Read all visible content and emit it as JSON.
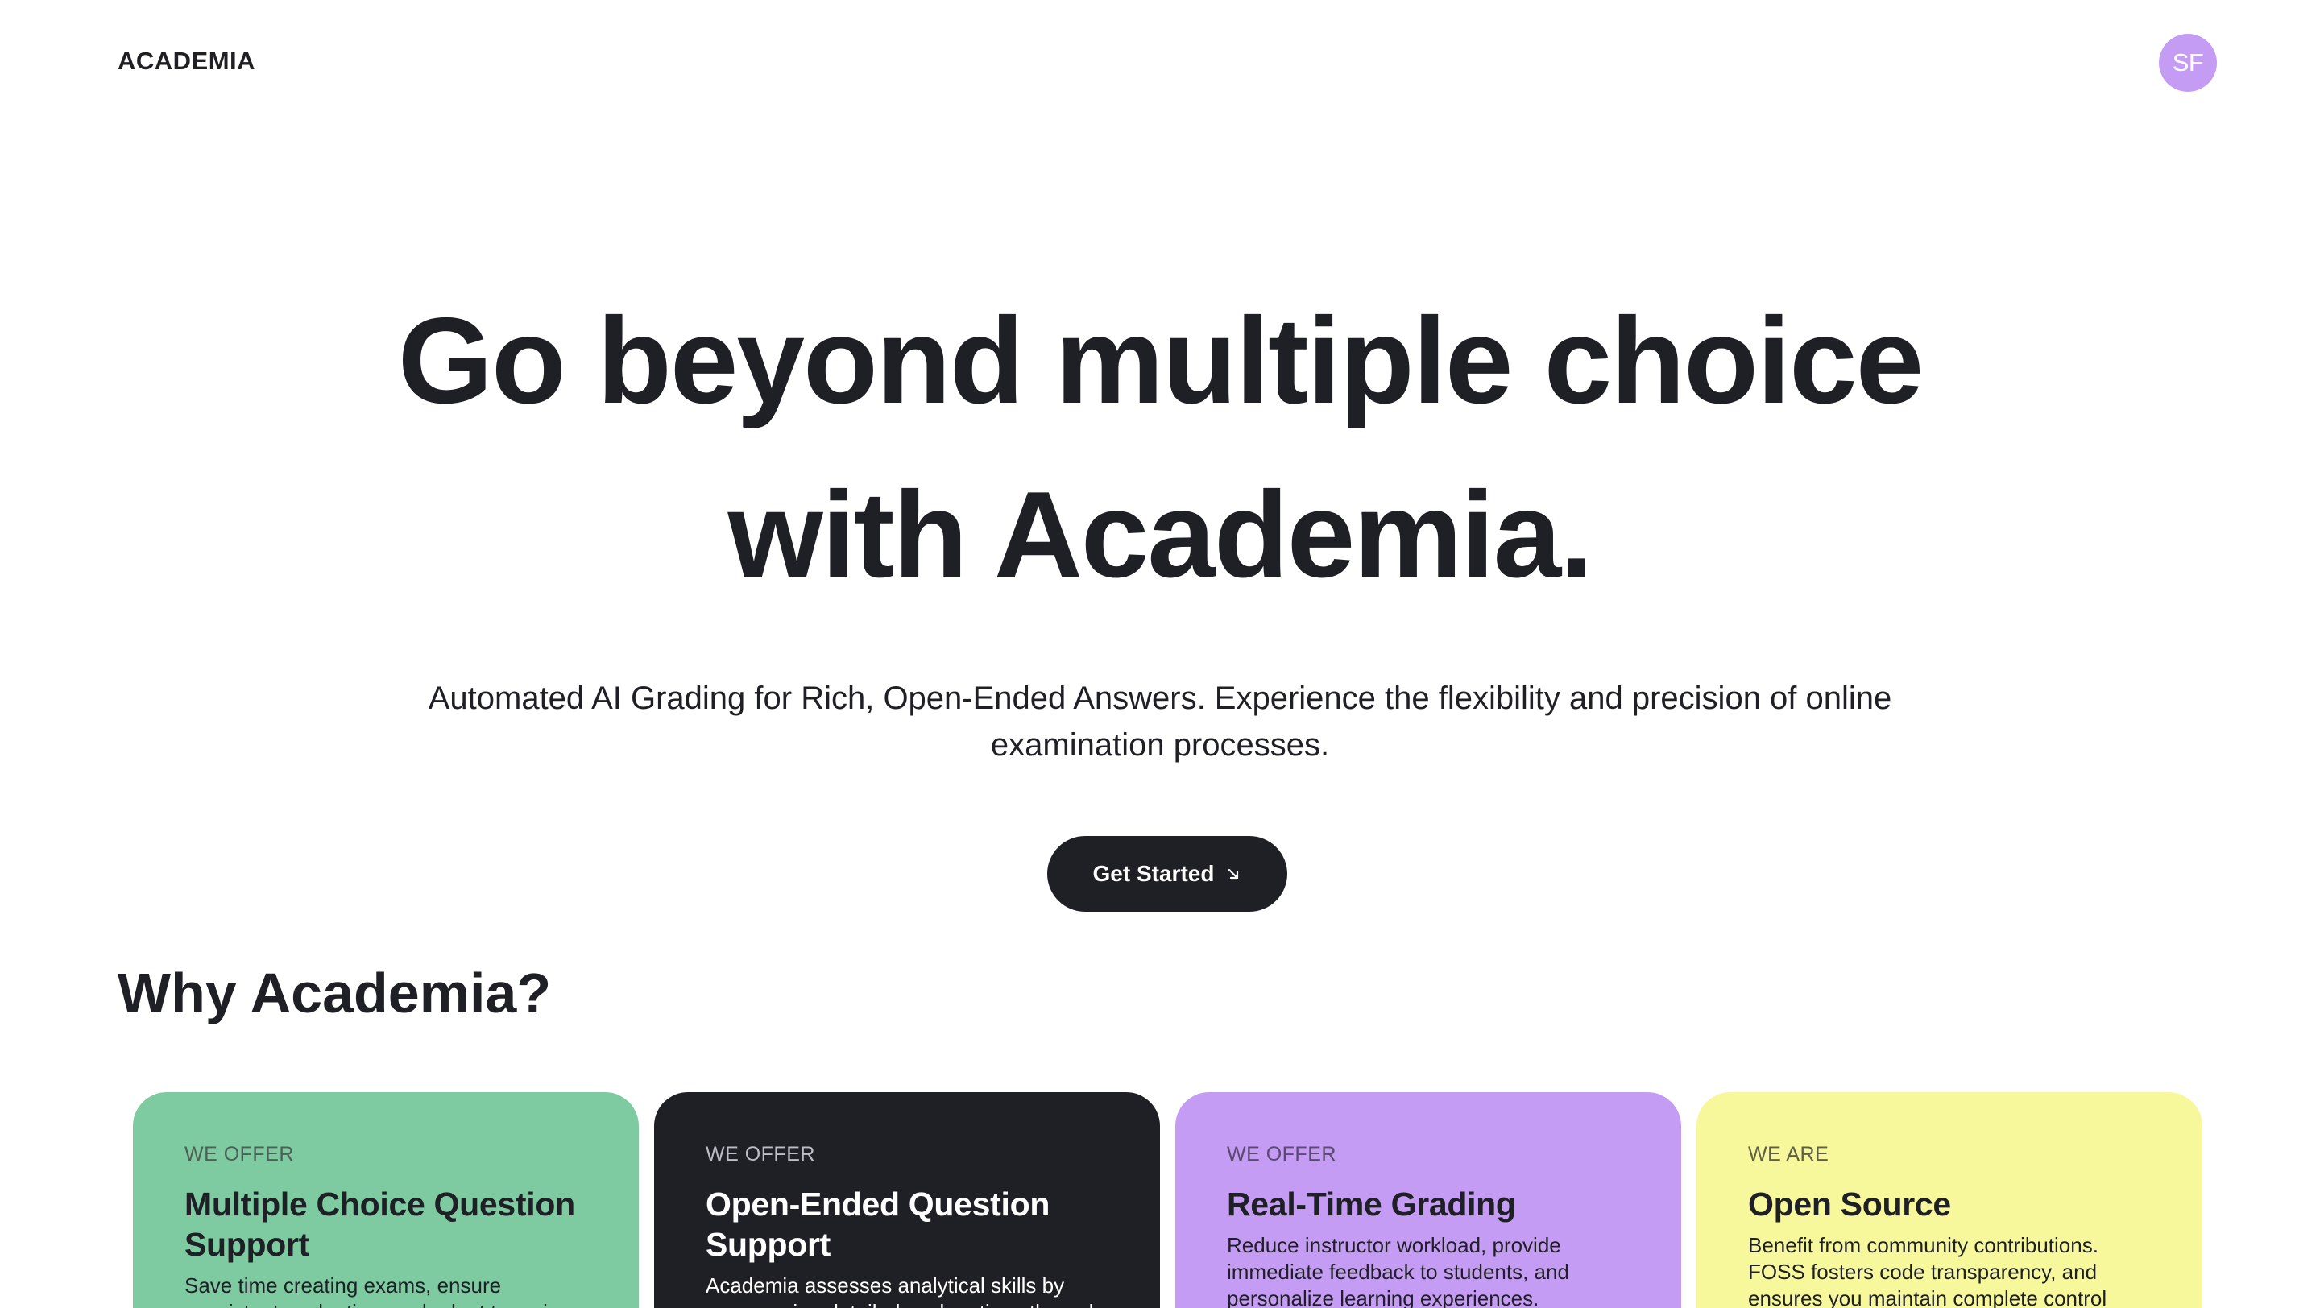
{
  "header": {
    "logo_text": "ACADEMIA",
    "avatar_initials": "SF"
  },
  "hero": {
    "title_line_1": "Go beyond multiple choice",
    "title_line_2": "with Academia.",
    "subtitle_line_1": "Automated AI Grading for Rich, Open-Ended Answers. Experience the flexibility and precision of online",
    "subtitle_line_2": "examination processes.",
    "cta_label": "Get Started",
    "cta_icon": "arrow-down-right-icon"
  },
  "why": {
    "title": "Why Academia?",
    "cards": [
      {
        "kicker": "WE OFFER",
        "title": "Multiple Choice Question Support",
        "description": "Save time creating exams, ensure consistent evaluation, and adapt to various learning",
        "color": "#7ecba1"
      },
      {
        "kicker": "WE OFFER",
        "title": "Open-Ended Question Support",
        "description": "Academia assesses analytical skills by encouraging detailed explanations through",
        "color": "#1f1f26"
      },
      {
        "kicker": "WE OFFER",
        "title": "Real-Time Grading",
        "description": "Reduce instructor workload, provide immediate feedback to students, and personalize learning experiences.",
        "color": "#c59cf3"
      },
      {
        "kicker": "WE ARE",
        "title": "Open Source",
        "description": "Benefit from community contributions. FOSS fosters code transparency, and ensures you maintain complete control over",
        "color": "#f7f89b"
      }
    ]
  }
}
